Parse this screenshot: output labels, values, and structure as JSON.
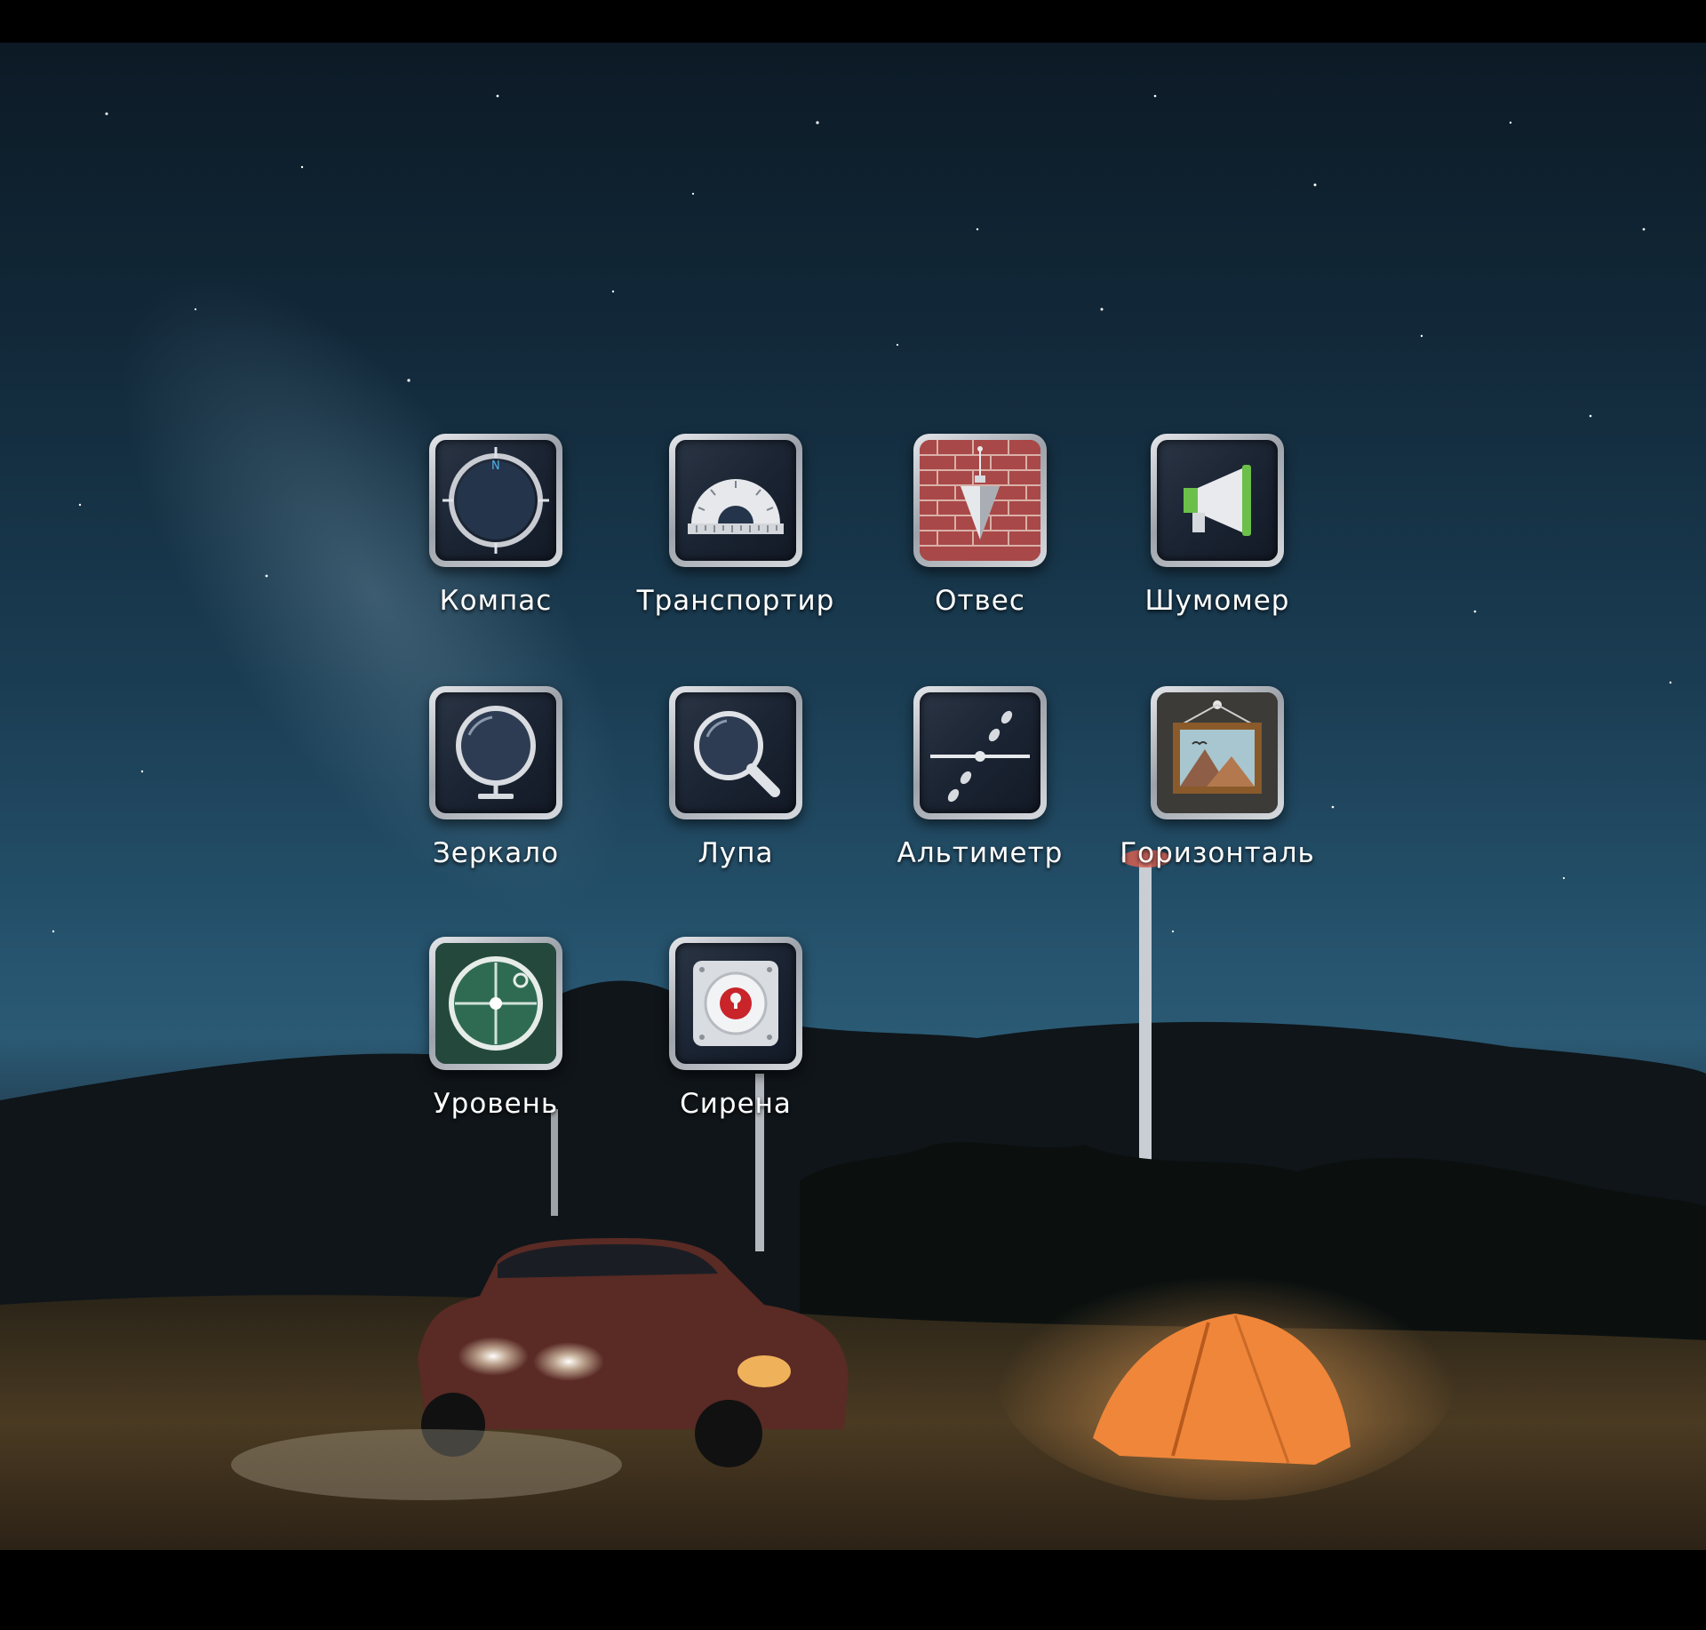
{
  "screen": {
    "background_color": "#000000",
    "label_color": "#ffffff"
  },
  "apps": [
    {
      "label": "Компас",
      "icon": "compass-icon"
    },
    {
      "label": "Транспортир",
      "icon": "protractor-icon"
    },
    {
      "label": "Отвес",
      "icon": "plumb-bob-icon"
    },
    {
      "label": "Шумомер",
      "icon": "megaphone-icon"
    },
    {
      "label": "Зеркало",
      "icon": "mirror-icon"
    },
    {
      "label": "Лупа",
      "icon": "magnifier-icon"
    },
    {
      "label": "Альтиметр",
      "icon": "altimeter-icon"
    },
    {
      "label": "Горизонталь",
      "icon": "picture-frame-icon"
    },
    {
      "label": "Уровень",
      "icon": "bubble-level-icon"
    },
    {
      "label": "Сирена",
      "icon": "siren-icon"
    }
  ]
}
